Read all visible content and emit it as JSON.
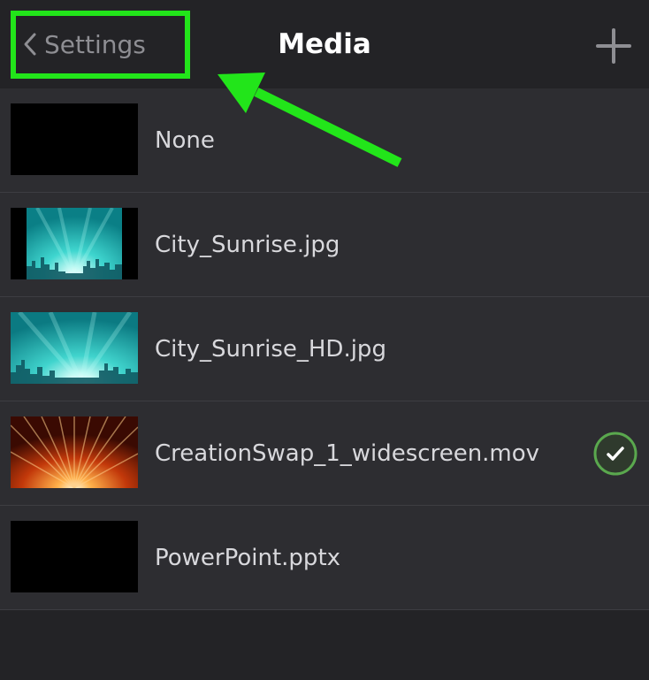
{
  "nav": {
    "back_label": "Settings",
    "title": "Media"
  },
  "items": [
    {
      "label": "None",
      "thumbnail": "black",
      "selected": false
    },
    {
      "label": "City_Sunrise.jpg",
      "thumbnail": "city-sunrise-letterboxed",
      "selected": false
    },
    {
      "label": "City_Sunrise_HD.jpg",
      "thumbnail": "city-sunrise-hd",
      "selected": false
    },
    {
      "label": "CreationSwap_1_widescreen.mov",
      "thumbnail": "orange-rays",
      "selected": true
    },
    {
      "label": "PowerPoint.pptx",
      "thumbnail": "black",
      "selected": false
    }
  ],
  "colors": {
    "annotation": "#22e51a",
    "check_ring": "#5aa84e",
    "background": "#2d2d31"
  }
}
